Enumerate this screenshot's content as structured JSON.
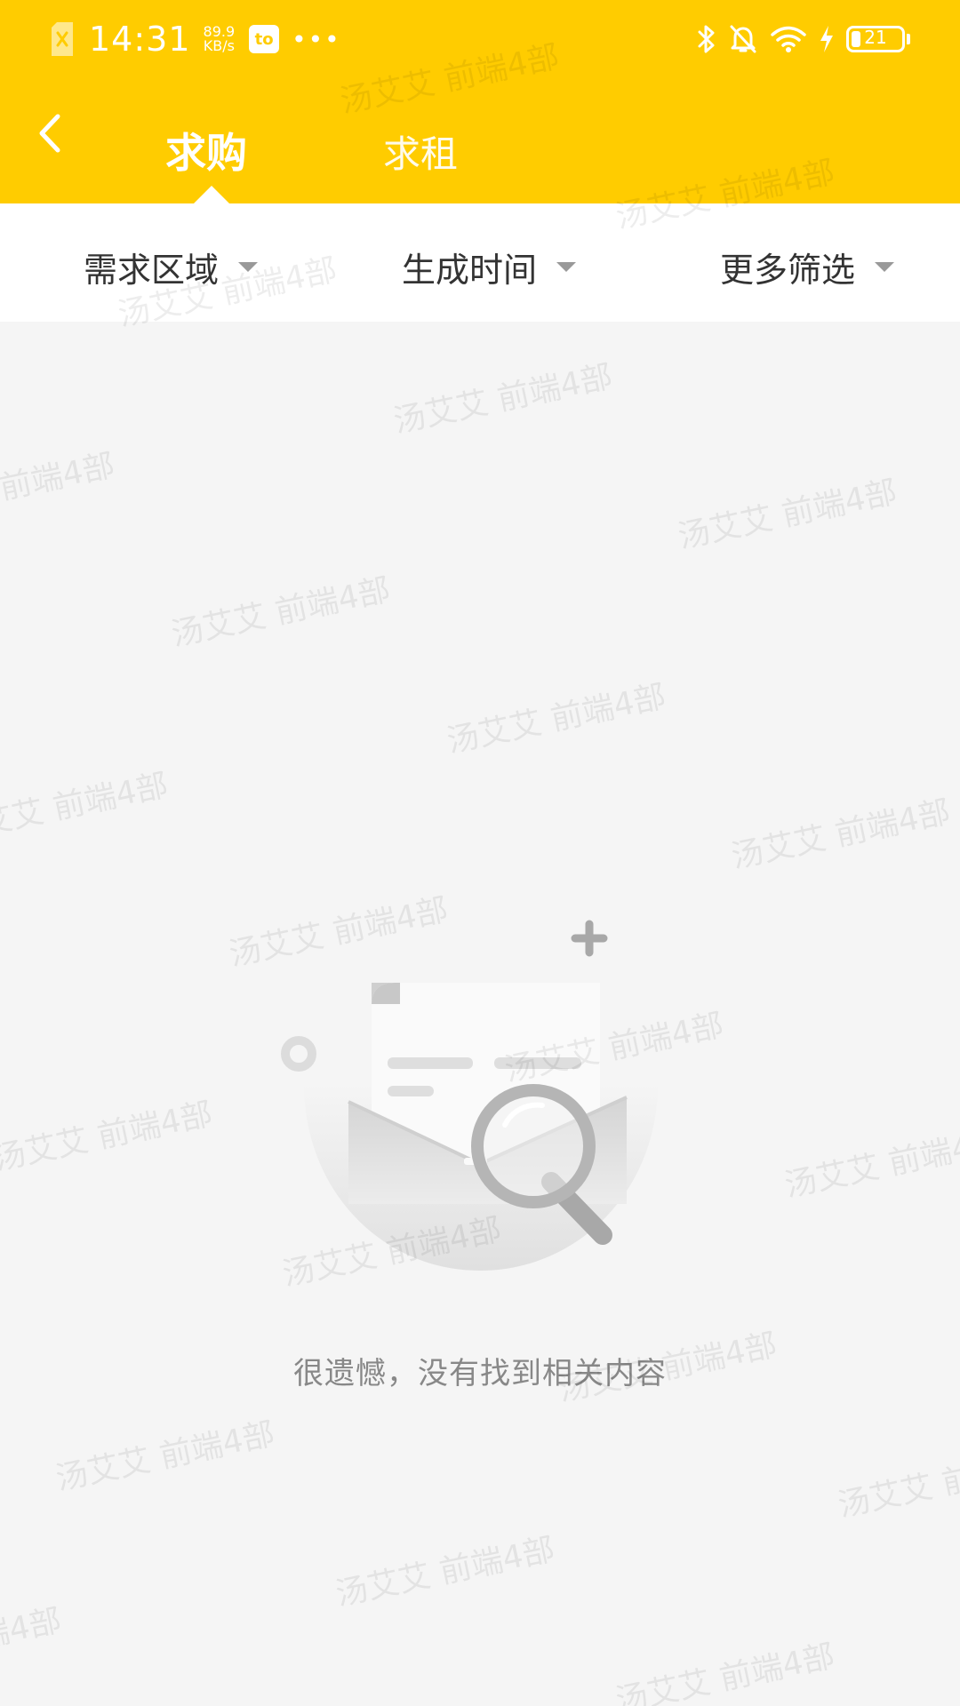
{
  "status_bar": {
    "time": "14:31",
    "net_speed_value": "89.9",
    "net_speed_unit": "KB/s",
    "app_badge": "to",
    "more_dots": "•••",
    "battery_level": "21"
  },
  "nav": {
    "tabs": [
      {
        "label": "求购",
        "active": true
      },
      {
        "label": "求租",
        "active": false
      }
    ]
  },
  "filters": [
    {
      "label": "需求区域"
    },
    {
      "label": "生成时间"
    },
    {
      "label": "更多筛选"
    }
  ],
  "empty_state": {
    "message": "很遗憾，没有找到相关内容"
  },
  "watermark": {
    "text": "汤艾艾 前端4部"
  },
  "colors": {
    "header_bg": "#ffcc00",
    "page_bg": "#f5f5f5",
    "filter_bg": "#ffffff",
    "filter_text": "#333333",
    "empty_text": "#888888"
  },
  "icons": {
    "back": "chevron-left-icon",
    "bluetooth": "bluetooth-icon",
    "mute": "bell-off-icon",
    "wifi": "wifi-icon",
    "charging": "lightning-icon",
    "empty": "envelope-search-illustration"
  }
}
